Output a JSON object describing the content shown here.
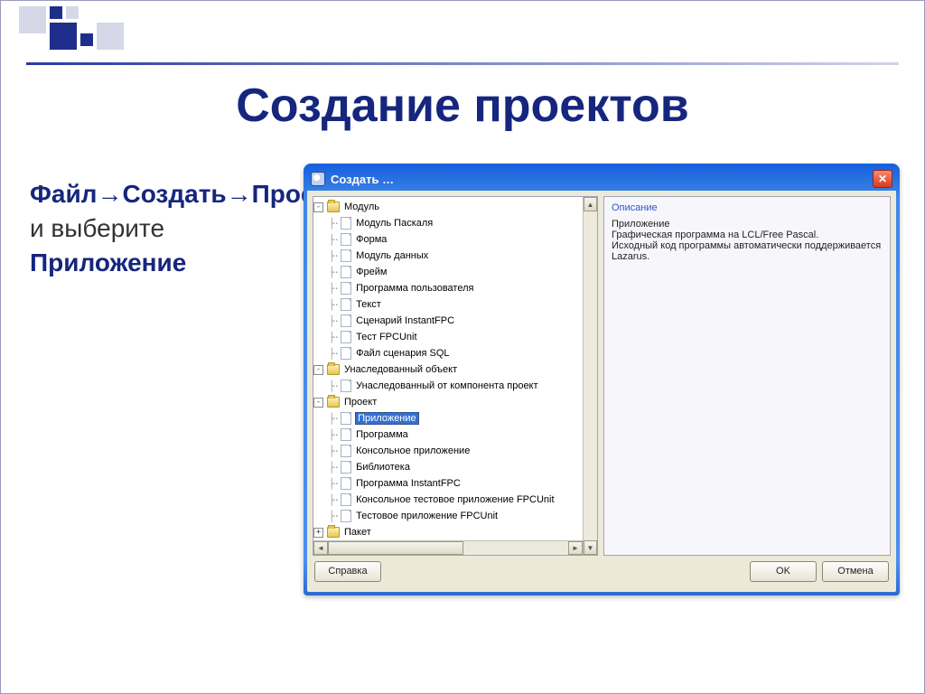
{
  "slide": {
    "title": "Создание проектов",
    "instruction_nav": "Файл→Создать→Проект",
    "instruction_mid": " и выберите ",
    "instruction_sel": "Приложение"
  },
  "dialog": {
    "title": "Создать …",
    "help_button": "Справка",
    "ok_button": "OK",
    "cancel_button": "Отмена",
    "desc_heading": "Описание",
    "desc_line1": "Приложение",
    "desc_line2": "Графическая программа на LCL/Free Pascal.",
    "desc_line3": "Исходный код программы автоматически поддерживается Lazarus."
  },
  "tree": [
    {
      "type": "folder",
      "level": 0,
      "exp": "-",
      "label": "Модуль"
    },
    {
      "type": "file",
      "level": 1,
      "label": "Модуль Паскаля"
    },
    {
      "type": "file",
      "level": 1,
      "label": "Форма"
    },
    {
      "type": "file",
      "level": 1,
      "label": "Модуль данных"
    },
    {
      "type": "file",
      "level": 1,
      "label": "Фрейм"
    },
    {
      "type": "file",
      "level": 1,
      "label": "Программа пользователя"
    },
    {
      "type": "file",
      "level": 1,
      "label": "Текст"
    },
    {
      "type": "file",
      "level": 1,
      "label": "Сценарий InstantFPC"
    },
    {
      "type": "file",
      "level": 1,
      "label": "Тест FPCUnit"
    },
    {
      "type": "file",
      "level": 1,
      "label": "Файл сценария SQL"
    },
    {
      "type": "folder",
      "level": 0,
      "exp": "-",
      "label": "Унаследованный объект"
    },
    {
      "type": "file",
      "level": 1,
      "label": "Унаследованный от компонента проект"
    },
    {
      "type": "folder",
      "level": 0,
      "exp": "-",
      "label": "Проект"
    },
    {
      "type": "file",
      "level": 1,
      "label": "Приложение",
      "selected": true
    },
    {
      "type": "file",
      "level": 1,
      "label": "Программа"
    },
    {
      "type": "file",
      "level": 1,
      "label": "Консольное приложение"
    },
    {
      "type": "file",
      "level": 1,
      "label": "Библиотека"
    },
    {
      "type": "file",
      "level": 1,
      "label": "Программа InstantFPC"
    },
    {
      "type": "file",
      "level": 1,
      "label": "Консольное тестовое приложение FPCUnit"
    },
    {
      "type": "file",
      "level": 1,
      "label": "Тестовое приложение FPCUnit"
    },
    {
      "type": "folder",
      "level": 0,
      "exp": "+",
      "label": "Пакет"
    }
  ]
}
